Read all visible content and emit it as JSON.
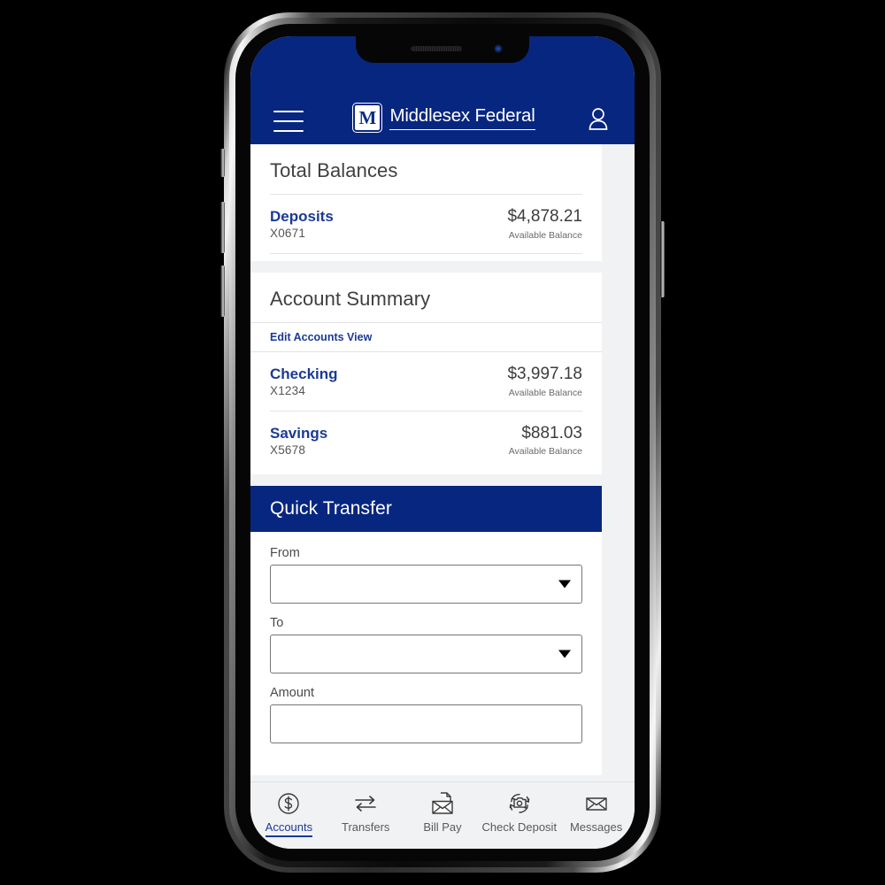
{
  "header": {
    "menu_icon": "hamburger-menu-icon",
    "logo_letter": "M",
    "brand_name": "Middlesex Federal",
    "profile_icon": "user-profile-icon"
  },
  "colors": {
    "brand_navy": "#072680",
    "link_blue": "#1b3a94",
    "page_background": "#f1f2f4",
    "card_background": "#ffffff"
  },
  "total_balances": {
    "title": "Total Balances",
    "rows": [
      {
        "name": "Deposits",
        "number": "X0671",
        "balance": "$4,878.21",
        "balance_label": "Available Balance"
      }
    ]
  },
  "account_summary": {
    "title": "Account Summary",
    "edit_link": "Edit Accounts View",
    "rows": [
      {
        "name": "Checking",
        "number": "X1234",
        "balance": "$3,997.18",
        "balance_label": "Available Balance"
      },
      {
        "name": "Savings",
        "number": "X5678",
        "balance": "$881.03",
        "balance_label": "Available Balance"
      }
    ]
  },
  "quick_transfer": {
    "title": "Quick Transfer",
    "fields": [
      {
        "label": "From",
        "value": "",
        "type": "select"
      },
      {
        "label": "To",
        "value": "",
        "type": "select"
      },
      {
        "label": "Amount",
        "value": "",
        "type": "text"
      }
    ]
  },
  "tabbar": {
    "items": [
      {
        "label": "Accounts",
        "icon": "dollar-circle-icon",
        "active": true
      },
      {
        "label": "Transfers",
        "icon": "transfer-arrows-icon",
        "active": false
      },
      {
        "label": "Bill Pay",
        "icon": "envelope-document-icon",
        "active": false
      },
      {
        "label": "Check Deposit",
        "icon": "camera-refresh-icon",
        "active": false
      },
      {
        "label": "Messages",
        "icon": "envelope-icon",
        "active": false
      }
    ]
  }
}
